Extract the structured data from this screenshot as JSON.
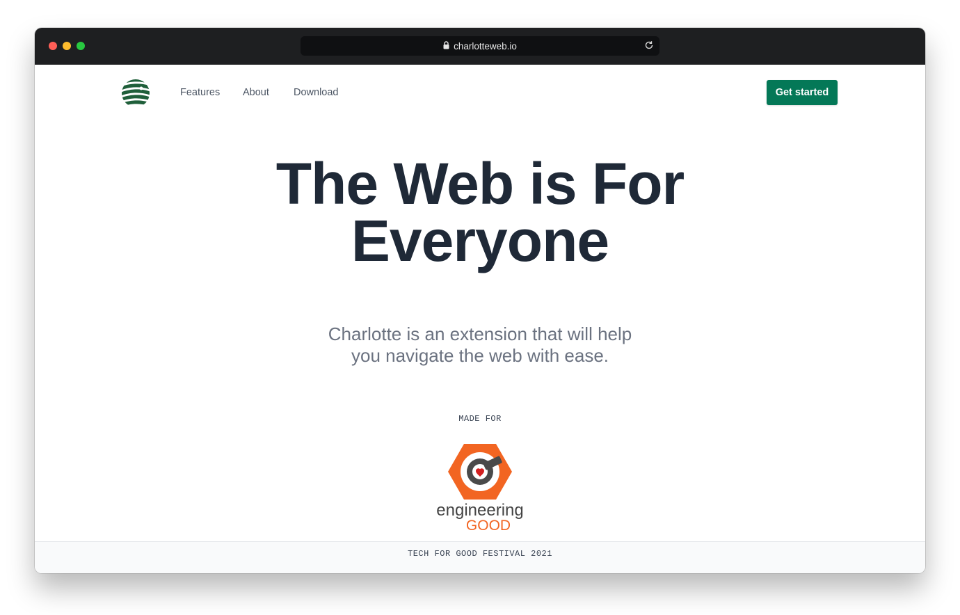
{
  "browser": {
    "url": "charlotteweb.io",
    "lock_icon": "lock-icon",
    "reload_icon": "reload-icon"
  },
  "nav": {
    "logo_icon": "globe-logo-icon",
    "links": [
      "Features",
      "About",
      "Download"
    ],
    "cta": "Get started"
  },
  "hero": {
    "title_line1": "The Web is For",
    "title_line2": "Everyone",
    "subtitle_line1": "Charlotte is an extension that will help",
    "subtitle_line2": "you navigate the web with ease."
  },
  "partner": {
    "made_for": "MADE FOR",
    "logo_word1": "engineering",
    "logo_word2": "GOOD",
    "festival": "TECH FOR GOOD FESTIVAL 2021"
  },
  "colors": {
    "accent": "#047857",
    "title": "#1f2937",
    "subtitle": "#6b7280",
    "partner_orange": "#f26522"
  }
}
